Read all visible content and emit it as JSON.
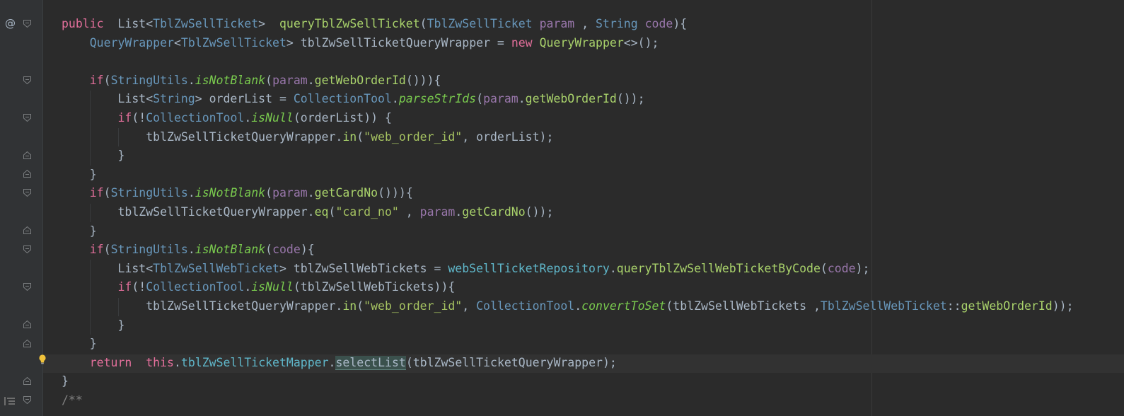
{
  "editor": {
    "lines": [
      [
        [
          "kwp",
          "public"
        ],
        [
          "p",
          "  "
        ],
        [
          "p",
          "List<"
        ],
        [
          "cls",
          "TblZwSellTicket"
        ],
        [
          "p",
          ">  "
        ],
        [
          "fn",
          "queryTblZwSellTicket"
        ],
        [
          "p",
          "("
        ],
        [
          "cls",
          "TblZwSellTicket"
        ],
        [
          "p",
          " "
        ],
        [
          "var",
          "param"
        ],
        [
          "p",
          " , "
        ],
        [
          "cls",
          "String"
        ],
        [
          "p",
          " "
        ],
        [
          "var",
          "code"
        ],
        [
          "p",
          "){"
        ]
      ],
      [
        [
          "p",
          "    "
        ],
        [
          "cls",
          "QueryWrapper"
        ],
        [
          "p",
          "<"
        ],
        [
          "cls",
          "TblZwSellTicket"
        ],
        [
          "p",
          "> tblZwSellTicketQueryWrapper = "
        ],
        [
          "kwp",
          "new"
        ],
        [
          "p",
          " "
        ],
        [
          "fn",
          "QueryWrapper"
        ],
        [
          "p",
          "<>();"
        ]
      ],
      [],
      [
        [
          "p",
          "    "
        ],
        [
          "kwp",
          "if"
        ],
        [
          "p",
          "("
        ],
        [
          "cls",
          "StringUtils"
        ],
        [
          "p",
          "."
        ],
        [
          "fni",
          "isNotBlank"
        ],
        [
          "p",
          "("
        ],
        [
          "var",
          "param"
        ],
        [
          "p",
          "."
        ],
        [
          "fn",
          "getWebOrderId"
        ],
        [
          "p",
          "())){"
        ]
      ],
      [
        [
          "p",
          "        List<"
        ],
        [
          "cls",
          "String"
        ],
        [
          "p",
          "> orderList = "
        ],
        [
          "cls",
          "CollectionTool"
        ],
        [
          "p",
          "."
        ],
        [
          "fni",
          "parseStrIds"
        ],
        [
          "p",
          "("
        ],
        [
          "var",
          "param"
        ],
        [
          "p",
          "."
        ],
        [
          "fn",
          "getWebOrderId"
        ],
        [
          "p",
          "());"
        ]
      ],
      [
        [
          "p",
          "        "
        ],
        [
          "kwp",
          "if"
        ],
        [
          "p",
          "(!"
        ],
        [
          "cls",
          "CollectionTool"
        ],
        [
          "p",
          "."
        ],
        [
          "fni",
          "isNull"
        ],
        [
          "p",
          "(orderList)) {"
        ]
      ],
      [
        [
          "p",
          "            tblZwSellTicketQueryWrapper."
        ],
        [
          "fn",
          "in"
        ],
        [
          "p",
          "("
        ],
        [
          "str",
          "\"web_order_id\""
        ],
        [
          "p",
          ", orderList);"
        ]
      ],
      [
        [
          "p",
          "        }"
        ]
      ],
      [
        [
          "p",
          "    }"
        ]
      ],
      [
        [
          "p",
          "    "
        ],
        [
          "kwp",
          "if"
        ],
        [
          "p",
          "("
        ],
        [
          "cls",
          "StringUtils"
        ],
        [
          "p",
          "."
        ],
        [
          "fni",
          "isNotBlank"
        ],
        [
          "p",
          "("
        ],
        [
          "var",
          "param"
        ],
        [
          "p",
          "."
        ],
        [
          "fn",
          "getCardNo"
        ],
        [
          "p",
          "())){"
        ]
      ],
      [
        [
          "p",
          "        tblZwSellTicketQueryWrapper."
        ],
        [
          "fn",
          "eq"
        ],
        [
          "p",
          "("
        ],
        [
          "str",
          "\"card_no\""
        ],
        [
          "p",
          " , "
        ],
        [
          "var",
          "param"
        ],
        [
          "p",
          "."
        ],
        [
          "fn",
          "getCardNo"
        ],
        [
          "p",
          "());"
        ]
      ],
      [
        [
          "p",
          "    }"
        ]
      ],
      [
        [
          "p",
          "    "
        ],
        [
          "kwp",
          "if"
        ],
        [
          "p",
          "("
        ],
        [
          "cls",
          "StringUtils"
        ],
        [
          "p",
          "."
        ],
        [
          "fni",
          "isNotBlank"
        ],
        [
          "p",
          "("
        ],
        [
          "var",
          "code"
        ],
        [
          "p",
          "){"
        ]
      ],
      [
        [
          "p",
          "        List<"
        ],
        [
          "cls",
          "TblZwSellWebTicket"
        ],
        [
          "p",
          "> tblZwSellWebTickets = "
        ],
        [
          "fld",
          "webSellTicketRepository"
        ],
        [
          "p",
          "."
        ],
        [
          "fn",
          "queryTblZwSellWebTicketByCode"
        ],
        [
          "p",
          "("
        ],
        [
          "var",
          "code"
        ],
        [
          "p",
          ");"
        ]
      ],
      [
        [
          "p",
          "        "
        ],
        [
          "kwp",
          "if"
        ],
        [
          "p",
          "(!"
        ],
        [
          "cls",
          "CollectionTool"
        ],
        [
          "p",
          "."
        ],
        [
          "fni",
          "isNull"
        ],
        [
          "p",
          "(tblZwSellWebTickets)){"
        ]
      ],
      [
        [
          "p",
          "            tblZwSellTicketQueryWrapper."
        ],
        [
          "fn",
          "in"
        ],
        [
          "p",
          "("
        ],
        [
          "str",
          "\"web_order_id\""
        ],
        [
          "p",
          ", "
        ],
        [
          "cls",
          "CollectionTool"
        ],
        [
          "p",
          "."
        ],
        [
          "fni",
          "convertToSet"
        ],
        [
          "p",
          "(tblZwSellWebTickets ,"
        ],
        [
          "cls",
          "TblZwSellWebTicket"
        ],
        [
          "p",
          "::"
        ],
        [
          "fn",
          "getWebOrderId"
        ],
        [
          "p",
          "));"
        ]
      ],
      [
        [
          "p",
          "        }"
        ]
      ],
      [
        [
          "p",
          "    }"
        ]
      ],
      [
        [
          "p",
          "    "
        ],
        [
          "kwp",
          "return"
        ],
        [
          "p",
          "  "
        ],
        [
          "kwp",
          "this"
        ],
        [
          "p",
          "."
        ],
        [
          "fld",
          "tblZwSellTicketMapper"
        ],
        [
          "p",
          "."
        ],
        [
          "hl",
          "selectList"
        ],
        [
          "p",
          "(tblZwSellTicketQueryWrapper);"
        ]
      ],
      [
        [
          "p",
          "}"
        ]
      ],
      [
        [
          "cm",
          "/**"
        ]
      ]
    ]
  },
  "gutter": {
    "override_marker": "@",
    "intention_icon": "lightbulb-icon",
    "fold_icon": "fold-marker-icon",
    "structure_icon": "structure-icon"
  },
  "theme": {
    "background": "#2b2b2b",
    "gutter": "#313335",
    "caret_row": "#323232",
    "keyword": "#e36f9b",
    "type": "#6897bb",
    "method": "#a9d26b",
    "string": "#a5c261",
    "param": "#9876aa",
    "field": "#5fb6c9"
  }
}
